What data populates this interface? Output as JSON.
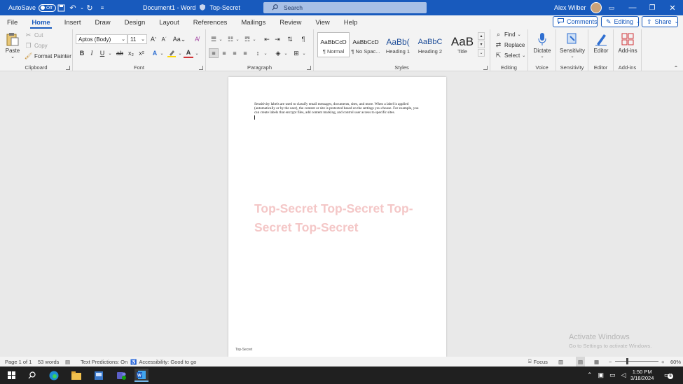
{
  "titlebar": {
    "autosave_label": "AutoSave",
    "autosave_state": "Off",
    "doc_title": "Document1 - Word",
    "label": "Top-Secret",
    "search_placeholder": "Search",
    "user_name": "Alex Wilber"
  },
  "tabs": [
    "File",
    "Home",
    "Insert",
    "Draw",
    "Design",
    "Layout",
    "References",
    "Mailings",
    "Review",
    "View",
    "Help"
  ],
  "active_tab": "Home",
  "tab_actions": {
    "comments": "Comments",
    "editing": "Editing",
    "share": "Share"
  },
  "ribbon": {
    "clipboard": {
      "label": "Clipboard",
      "paste": "Paste",
      "cut": "Cut",
      "copy": "Copy",
      "format_painter": "Format Painter"
    },
    "font": {
      "label": "Font",
      "family": "Aptos (Body)",
      "size": "11"
    },
    "paragraph": {
      "label": "Paragraph"
    },
    "styles": {
      "label": "Styles",
      "items": [
        {
          "sample": "AaBbCcD",
          "name": "¶ Normal"
        },
        {
          "sample": "AaBbCcD",
          "name": "¶ No Spac..."
        },
        {
          "sample": "AaBb(",
          "name": "Heading 1"
        },
        {
          "sample": "AaBbC",
          "name": "Heading 2"
        },
        {
          "sample": "AaB",
          "name": "Title"
        }
      ]
    },
    "editing": {
      "label": "Editing",
      "find": "Find",
      "replace": "Replace",
      "select": "Select"
    },
    "voice": {
      "label": "Voice",
      "dictate": "Dictate"
    },
    "sensitivity": {
      "label": "Sensitivity",
      "button": "Sensitivity"
    },
    "editor": {
      "label": "Editor",
      "button": "Editor"
    },
    "addins": {
      "label": "Add-ins",
      "button": "Add-ins"
    }
  },
  "document": {
    "body": "Sensitivity labels are used to classify email messages, documents, sites, and more. When a label is applied (automatically or by the user), the content or site is protected based on the settings you choose. For example, you can create labels that encrypt files, add content marking, and control user access to specific sites.",
    "watermark": "Top-Secret Top-Secret Top-Secret Top-Secret",
    "footer": "Top-Secret"
  },
  "activation": {
    "title": "Activate Windows",
    "subtitle": "Go to Settings to activate Windows."
  },
  "status": {
    "page": "Page 1 of 1",
    "words": "53 words",
    "text_predictions": "Text Predictions: On",
    "accessibility": "Accessibility: Good to go",
    "focus": "Focus",
    "zoom": "60%"
  },
  "taskbar": {
    "time": "1:50 PM",
    "date": "3/18/2024",
    "notification_count": "6"
  }
}
